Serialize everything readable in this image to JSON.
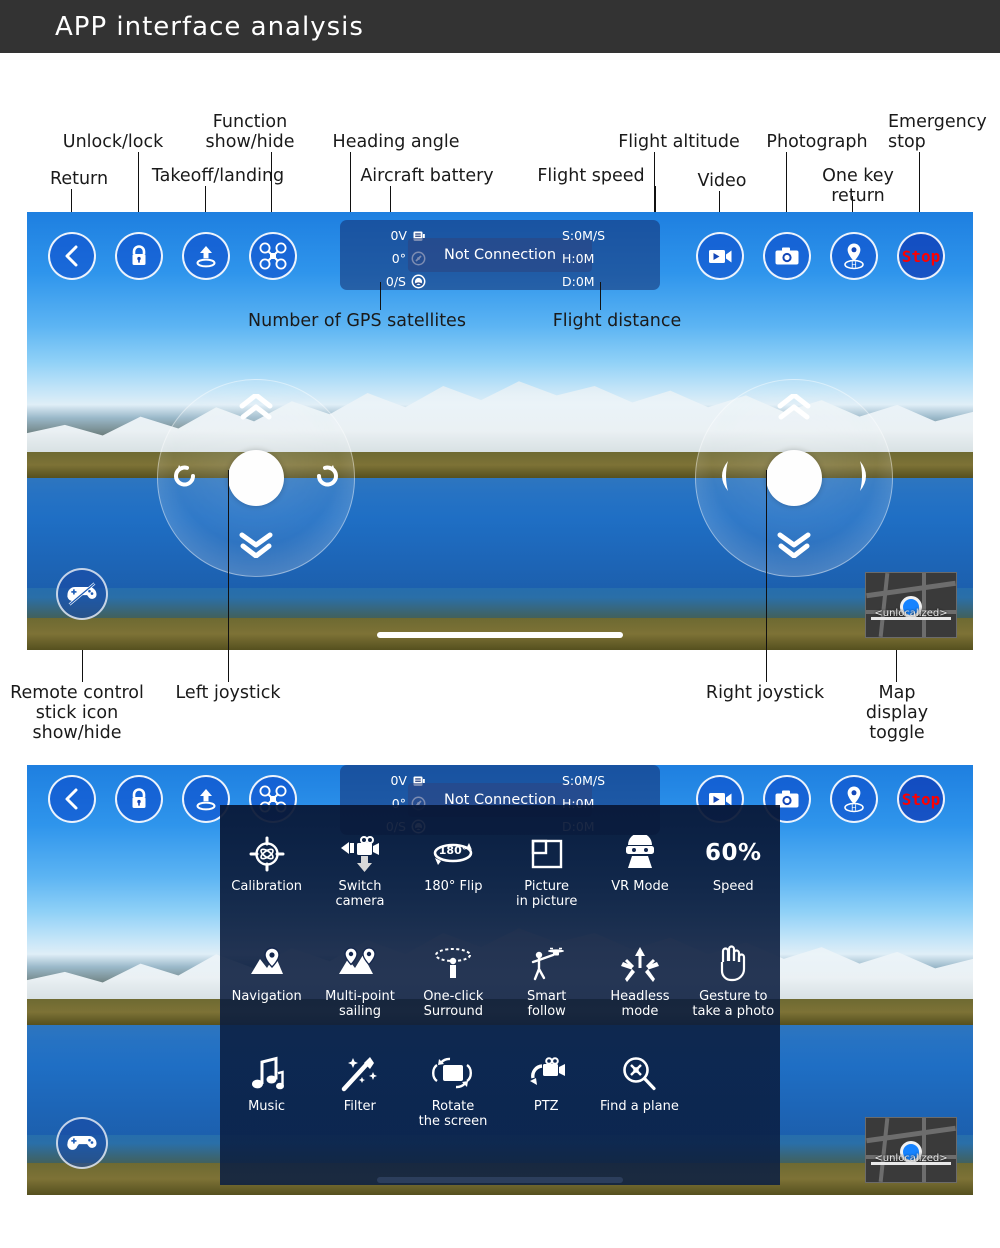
{
  "header": {
    "title": "APP interface analysis"
  },
  "annotations": {
    "top": [
      {
        "id": "return",
        "text": "Return"
      },
      {
        "id": "unlock-lock",
        "text": "Unlock/lock"
      },
      {
        "id": "takeoff-landing",
        "text": "Takeoff/landing"
      },
      {
        "id": "function-show-hide",
        "text": "Function\nshow/hide"
      },
      {
        "id": "heading-angle",
        "text": "Heading angle"
      },
      {
        "id": "aircraft-battery",
        "text": "Aircraft battery"
      },
      {
        "id": "flight-speed",
        "text": "Flight speed"
      },
      {
        "id": "flight-altitude",
        "text": "Flight altitude"
      },
      {
        "id": "video",
        "text": "Video"
      },
      {
        "id": "photograph",
        "text": "Photograph"
      },
      {
        "id": "one-key-return",
        "text": "One key\nreturn"
      },
      {
        "id": "emergency-stop",
        "text": "Emergency\nstop"
      }
    ],
    "middle": [
      {
        "id": "gps-satellites",
        "text": "Number of GPS satellites"
      },
      {
        "id": "flight-distance",
        "text": "Flight distance"
      }
    ],
    "bottom": [
      {
        "id": "remote-stick-toggle",
        "text": "Remote control\nstick icon\nshow/hide"
      },
      {
        "id": "left-joystick",
        "text": "Left joystick"
      },
      {
        "id": "right-joystick",
        "text": "Right joystick"
      },
      {
        "id": "map-display-toggle",
        "text": "Map\ndisplay toggle"
      }
    ]
  },
  "hud": {
    "battery_voltage": "0V",
    "heading_angle": "0°",
    "gps_satellites": "0/S",
    "connection_status": "Not Connection",
    "speed": "S:0M/S",
    "altitude": "H:0M",
    "distance": "D:0M",
    "icons": {
      "battery": "battery-icon",
      "compass": "compass-icon",
      "satellite": "satellite-icon"
    }
  },
  "toolbar_left": [
    {
      "id": "return",
      "icon": "chevron-left-icon"
    },
    {
      "id": "unlock-lock",
      "icon": "lock-icon"
    },
    {
      "id": "takeoff-landing",
      "icon": "takeoff-arrow-icon"
    },
    {
      "id": "function-toggle",
      "icon": "drone-icon"
    }
  ],
  "toolbar_right": [
    {
      "id": "video",
      "icon": "video-camera-icon",
      "label": ""
    },
    {
      "id": "photograph",
      "icon": "camera-icon",
      "label": ""
    },
    {
      "id": "one-key-return",
      "icon": "home-pin-icon",
      "label": ""
    },
    {
      "id": "emergency-stop",
      "icon": "stop-icon",
      "label": "Stop"
    }
  ],
  "joysticks": {
    "left": {
      "name": "left-joystick",
      "up": "chevron-up-double",
      "down": "chevron-down-double",
      "left": "rotate-left-icon",
      "right": "rotate-right-icon"
    },
    "right": {
      "name": "right-joystick",
      "up": "chevron-up-double",
      "down": "chevron-down-double",
      "left": "triangle-left-icon",
      "right": "triangle-right-icon"
    }
  },
  "stick_toggle": {
    "icon": "gamepad-slash-icon"
  },
  "minimap": {
    "label": "<unlocalized>"
  },
  "menu": {
    "rows": [
      [
        {
          "id": "calibration",
          "icon": "calibration-icon",
          "label": "Calibration"
        },
        {
          "id": "switch-camera",
          "icon": "switch-camera-icon",
          "label": "Switch\ncamera"
        },
        {
          "id": "flip-180",
          "icon": "flip-180-icon",
          "label": "180° Flip"
        },
        {
          "id": "picture-in-picture",
          "icon": "pip-icon",
          "label": "Picture\nin picture"
        },
        {
          "id": "vr-mode",
          "icon": "vr-mode-icon",
          "label": "VR Mode"
        },
        {
          "id": "speed",
          "icon": "speed-percent",
          "label": "Speed",
          "value": "60%"
        }
      ],
      [
        {
          "id": "navigation",
          "icon": "navigation-icon",
          "label": "Navigation"
        },
        {
          "id": "multi-point-sailing",
          "icon": "multi-point-icon",
          "label": "Multi-point\nsailing"
        },
        {
          "id": "one-click-surround",
          "icon": "surround-icon",
          "label": "One-click\nSurround"
        },
        {
          "id": "smart-follow",
          "icon": "follow-icon",
          "label": "Smart\nfollow"
        },
        {
          "id": "headless-mode",
          "icon": "headless-icon",
          "label": "Headless\nmode"
        },
        {
          "id": "gesture-photo",
          "icon": "gesture-hand-icon",
          "label": "Gesture to\ntake a photo"
        }
      ],
      [
        {
          "id": "music",
          "icon": "music-note-icon",
          "label": "Music"
        },
        {
          "id": "filter",
          "icon": "magic-wand-icon",
          "label": "Filter"
        },
        {
          "id": "rotate-screen",
          "icon": "rotate-screen-icon",
          "label": "Rotate\nthe screen"
        },
        {
          "id": "ptz",
          "icon": "ptz-camera-icon",
          "label": "PTZ"
        },
        {
          "id": "find-a-plane",
          "icon": "find-plane-icon",
          "label": "Find a plane"
        }
      ]
    ]
  },
  "colors": {
    "titlebar_bg": "#333333",
    "stop_red": "#ff0000",
    "hud_blue": "#2c4682",
    "accent_blue": "#1683ff"
  }
}
